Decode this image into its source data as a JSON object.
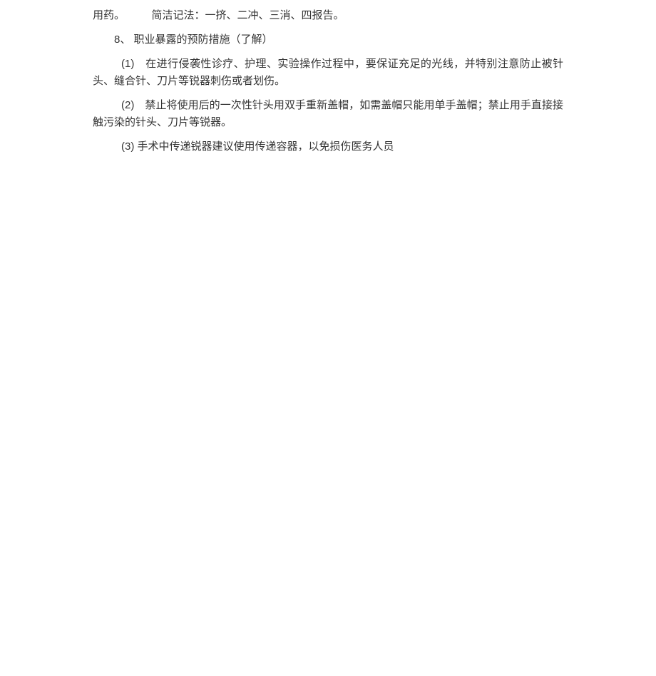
{
  "document": {
    "paragraphs": [
      {
        "text": "用药。　　　简洁记法：一挤、二冲、三消、四报告。",
        "css_class": "indent-1"
      },
      {
        "text": "8、 职业暴露的预防措施（了解）",
        "css_class": "indent-2"
      },
      {
        "text": "(1)　在进行侵袭性诊疗、护理、实验操作过程中，要保证充足的光线，并特别注意防止被针头、缝合针、刀片等锐器刺伤或者划伤。",
        "css_class": "hanging"
      },
      {
        "text": "(2)　禁止将使用后的一次性针头用双手重新盖帽，如需盖帽只能用单手盖帽；禁止用手直接接触污染的针头、刀片等锐器。",
        "css_class": "hanging"
      },
      {
        "text": "(3) 手术中传递锐器建议使用传递容器，以免损伤医务人员",
        "css_class": "indent-3"
      }
    ]
  }
}
